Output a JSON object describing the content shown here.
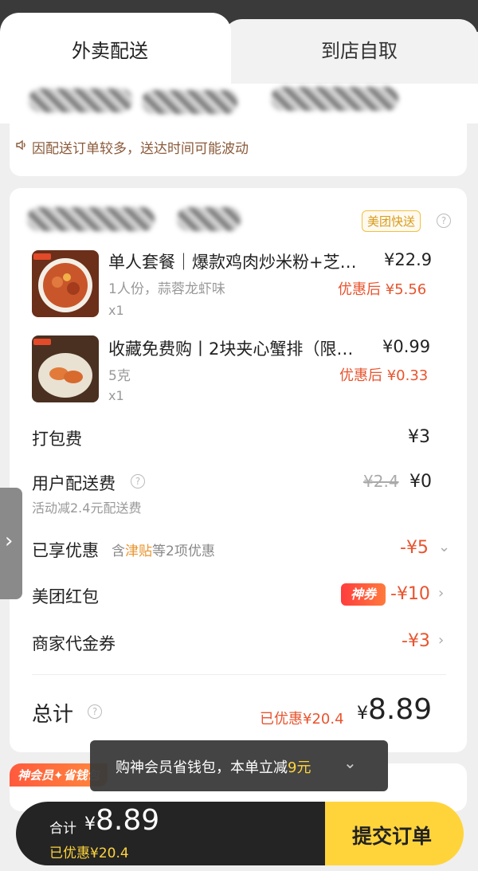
{
  "tabs": {
    "delivery": "外卖配送",
    "pickup": "到店自取"
  },
  "notice": {
    "text": "因配送订单较多，送达时间可能波动"
  },
  "store": {
    "badge": "美团快送"
  },
  "items": [
    {
      "name": "单人套餐｜爆款鸡肉炒米粉+芝…",
      "spec": "1人份，蒜蓉龙虾味",
      "qty": "x1",
      "price": "¥22.9",
      "discount": "优惠后 ¥5.56"
    },
    {
      "name": "收藏免费购丨2块夹心蟹排（限…",
      "spec": "5克",
      "qty": "x1",
      "price": "¥0.99",
      "discount": "优惠后 ¥0.33"
    }
  ],
  "fees": {
    "packing_label": "打包费",
    "packing_value": "¥3",
    "delivery_label": "用户配送费",
    "delivery_original": "¥2.4",
    "delivery_value": "¥0",
    "delivery_note": "活动减2.4元配送费"
  },
  "discounts": {
    "enjoyed_label": "已享优惠",
    "enjoyed_prefix": "含",
    "enjoyed_highlight": "津贴",
    "enjoyed_suffix": "等2项优惠",
    "enjoyed_value": "-¥5",
    "redpacket_label": "美团红包",
    "redpacket_badge": "神券",
    "redpacket_value": "-¥10",
    "voucher_label": "商家代金券",
    "voucher_value": "-¥3"
  },
  "total": {
    "label": "总计",
    "saved": "已优惠¥20.4",
    "currency": "¥",
    "value": "8.89"
  },
  "member": {
    "badge": "神会员✦省钱包"
  },
  "toast": {
    "text": "购神会员省钱包，本单立减",
    "amount": "9元"
  },
  "bottom": {
    "total_label": "合计",
    "currency": "¥",
    "total_value": "8.89",
    "saved": "已优惠¥20.4",
    "submit": "提交订单"
  },
  "icons": {
    "speaker": "speaker-icon",
    "help": "question-circle-icon",
    "chevron": "chevron-right-icon"
  },
  "colors": {
    "accent_red": "#e8542e",
    "accent_yellow": "#ffd43b",
    "dark": "#242424"
  }
}
